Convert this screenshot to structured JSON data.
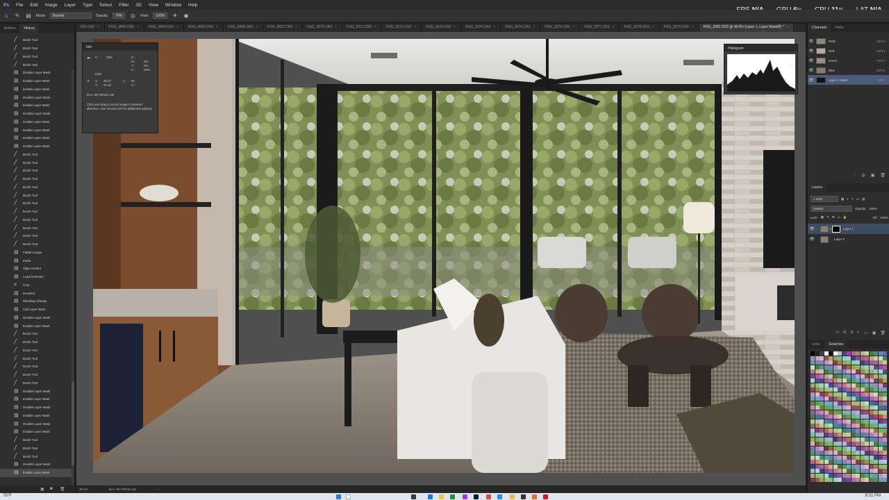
{
  "menu": [
    "File",
    "Edit",
    "Image",
    "Layer",
    "Type",
    "Select",
    "Filter",
    "3D",
    "View",
    "Window",
    "Help"
  ],
  "performance": [
    {
      "label": "FPS",
      "value": "N/A"
    },
    {
      "label": "GPU",
      "value": "6",
      "unit": "%"
    },
    {
      "label": "CPU",
      "value": "11",
      "unit": "%"
    },
    {
      "label": "LAT",
      "value": "N/A"
    }
  ],
  "options": {
    "mode_label": "Mode:",
    "mode_value": "Normal",
    "opacity_label": "Opacity:",
    "opacity_value": "70%",
    "flow_label": "Flow:",
    "flow_value": "100%"
  },
  "tabs": [
    "832.CR3",
    "FGG_2833.CR3",
    "FGG_2834.CR3",
    "FGG_2835.CR3",
    "FGG_2836.CR3",
    "FGG_2837.CR3",
    "FGG_3270.CR3",
    "FGG_3271.CR3",
    "FGG_3272.CR3",
    "FGG_3273.CR3",
    "FGG_3274.CR3",
    "FGG_3275.CR3",
    "FGG_3276.CR3",
    "FGG_3277.CR3",
    "FGG_3278.CR3",
    "FGG_3279.CR3"
  ],
  "active_tab": "FGG_3282.CR3 @ 36.6% (Layer 1, Layer Mask/8) *",
  "left_panel": {
    "tabs": [
      "Actions",
      "History"
    ],
    "history": [
      {
        "icon": "brush",
        "label": "Brush Tool"
      },
      {
        "icon": "brush",
        "label": "Brush Tool"
      },
      {
        "icon": "brush",
        "label": "Brush Tool"
      },
      {
        "icon": "brush",
        "label": "Brush Tool"
      },
      {
        "icon": "mask",
        "label": "Disable Layer Mask"
      },
      {
        "icon": "mask",
        "label": "Enable Layer Mask"
      },
      {
        "icon": "mask",
        "label": "Enable Layer Mask"
      },
      {
        "icon": "mask",
        "label": "Disable Layer Mask"
      },
      {
        "icon": "mask",
        "label": "Enable Layer Mask"
      },
      {
        "icon": "mask",
        "label": "Disable Layer Mask"
      },
      {
        "icon": "mask",
        "label": "Enable Layer Mask"
      },
      {
        "icon": "mask",
        "label": "Enable Layer Mask"
      },
      {
        "icon": "mask",
        "label": "Enable Layer Mask"
      },
      {
        "icon": "mask",
        "label": "Enable Layer Mask"
      },
      {
        "icon": "brush",
        "label": "Brush Tool"
      },
      {
        "icon": "brush",
        "label": "Brush Tool"
      },
      {
        "icon": "brush",
        "label": "Brush Tool"
      },
      {
        "icon": "brush",
        "label": "Brush Tool"
      },
      {
        "icon": "brush",
        "label": "Brush Tool"
      },
      {
        "icon": "brush",
        "label": "Brush Tool"
      },
      {
        "icon": "brush",
        "label": "Brush Tool"
      },
      {
        "icon": "brush",
        "label": "Brush Tool"
      },
      {
        "icon": "brush",
        "label": "Brush Tool"
      },
      {
        "icon": "brush",
        "label": "Brush Tool"
      },
      {
        "icon": "brush",
        "label": "Brush Tool"
      },
      {
        "icon": "brush",
        "label": "Brush Tool"
      },
      {
        "icon": "doc",
        "label": "Flatten Image"
      },
      {
        "icon": "doc",
        "label": "Paste"
      },
      {
        "icon": "doc",
        "label": "Align content"
      },
      {
        "icon": "doc",
        "label": "Load Selection"
      },
      {
        "icon": "crop",
        "label": "Crop"
      },
      {
        "icon": "doc",
        "label": "Deselect"
      },
      {
        "icon": "doc",
        "label": "Blending Change"
      },
      {
        "icon": "mask",
        "label": "Add Layer Mask"
      },
      {
        "icon": "mask",
        "label": "Disable Layer Mask"
      },
      {
        "icon": "mask",
        "label": "Enable Layer Mask"
      },
      {
        "icon": "brush",
        "label": "Brush Tool"
      },
      {
        "icon": "brush",
        "label": "Brush Tool"
      },
      {
        "icon": "brush",
        "label": "Brush Tool"
      },
      {
        "icon": "brush",
        "label": "Brush Tool"
      },
      {
        "icon": "brush",
        "label": "Brush Tool"
      },
      {
        "icon": "brush",
        "label": "Brush Tool"
      },
      {
        "icon": "brush",
        "label": "Brush Tool"
      },
      {
        "icon": "mask",
        "label": "Disable Layer Mask"
      },
      {
        "icon": "mask",
        "label": "Enable Layer Mask"
      },
      {
        "icon": "mask",
        "label": "Disable Layer Mask"
      },
      {
        "icon": "mask",
        "label": "Enable Layer Mask"
      },
      {
        "icon": "mask",
        "label": "Disable Layer Mask"
      },
      {
        "icon": "mask",
        "label": "Enable Layer Mask"
      },
      {
        "icon": "brush",
        "label": "Brush Tool"
      },
      {
        "icon": "brush",
        "label": "Brush Tool"
      },
      {
        "icon": "brush",
        "label": "Brush Tool"
      },
      {
        "icon": "mask",
        "label": "Disable Layer Mask"
      },
      {
        "icon": "mask",
        "label": "Enable Layer Mask"
      }
    ]
  },
  "info_panel": {
    "title": "Info",
    "c_label": "C :",
    "c_val": "20%",
    "m_label": "M :",
    "m_val": "0%",
    "y_label": "Y :",
    "y_val": "0%",
    "k_label": "K :",
    "k_val": "20%",
    "bit_label": "8-bit",
    "x_label": "X :",
    "x_val": "26.07",
    "y2_label": "Y :",
    "y2_val": "21.62",
    "w_label": "W :",
    "h_label": "H :",
    "doc": "Doc: 68.7M/151.1M",
    "hint": "Click and drag to scroll image in desired direction. Use Alt and Ctrl for additional options."
  },
  "histogram": {
    "title": "Histogram"
  },
  "channels": {
    "tabs": [
      "Channels",
      "Paths"
    ],
    "rows": [
      {
        "name": "RGB",
        "shortcut": "Ctrl+2"
      },
      {
        "name": "Red",
        "shortcut": "Ctrl+3"
      },
      {
        "name": "Green",
        "shortcut": "Ctrl+4"
      },
      {
        "name": "Blue",
        "shortcut": "Ctrl+5"
      },
      {
        "name": "Layer 1 Mask",
        "shortcut": "Ctrl+\\"
      }
    ]
  },
  "layers": {
    "title": "Layers",
    "kind": "Kind",
    "blend": "Darken",
    "opacity_label": "Opacity:",
    "opacity_value": "100%",
    "lock_label": "Lock:",
    "fill_label": "Fill:",
    "fill_value": "100%",
    "rows": [
      {
        "name": "Layer 1"
      },
      {
        "name": "Layer 0"
      }
    ]
  },
  "color_tabs": [
    "Color",
    "Swatches"
  ],
  "status": {
    "zoom": "36.6%",
    "doc": "Doc: 68.7M/151.1M"
  },
  "taskbar": {
    "temp": "78°F",
    "time": "8:21 PM"
  }
}
